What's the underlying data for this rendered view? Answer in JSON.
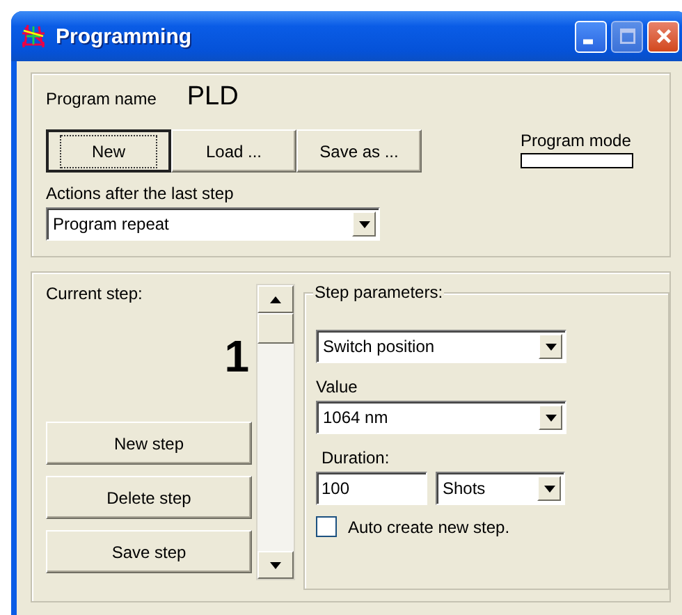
{
  "window": {
    "title": "Programming"
  },
  "program": {
    "name_label": "Program name",
    "name": "PLD",
    "mode_label": "Program mode"
  },
  "program_buttons": [
    {
      "label": "New",
      "focused": true
    },
    {
      "label": "Load ...",
      "focused": false
    },
    {
      "label": "Save as ...",
      "focused": false
    }
  ],
  "after_last_step": {
    "label": "Actions after the last step",
    "value": "Program repeat"
  },
  "current_step": {
    "label": "Current step:",
    "number": "1"
  },
  "step_buttons": [
    "New step",
    "Delete step",
    "Save step"
  ],
  "step_parameters": {
    "title": "Step parameters:",
    "type_value": "Switch position",
    "value_label": "Value",
    "value": "1064 nm",
    "duration_label": "Duration:",
    "duration": "100",
    "duration_unit": "Shots",
    "auto_create": {
      "label": "Auto create new step.",
      "checked": false
    }
  }
}
